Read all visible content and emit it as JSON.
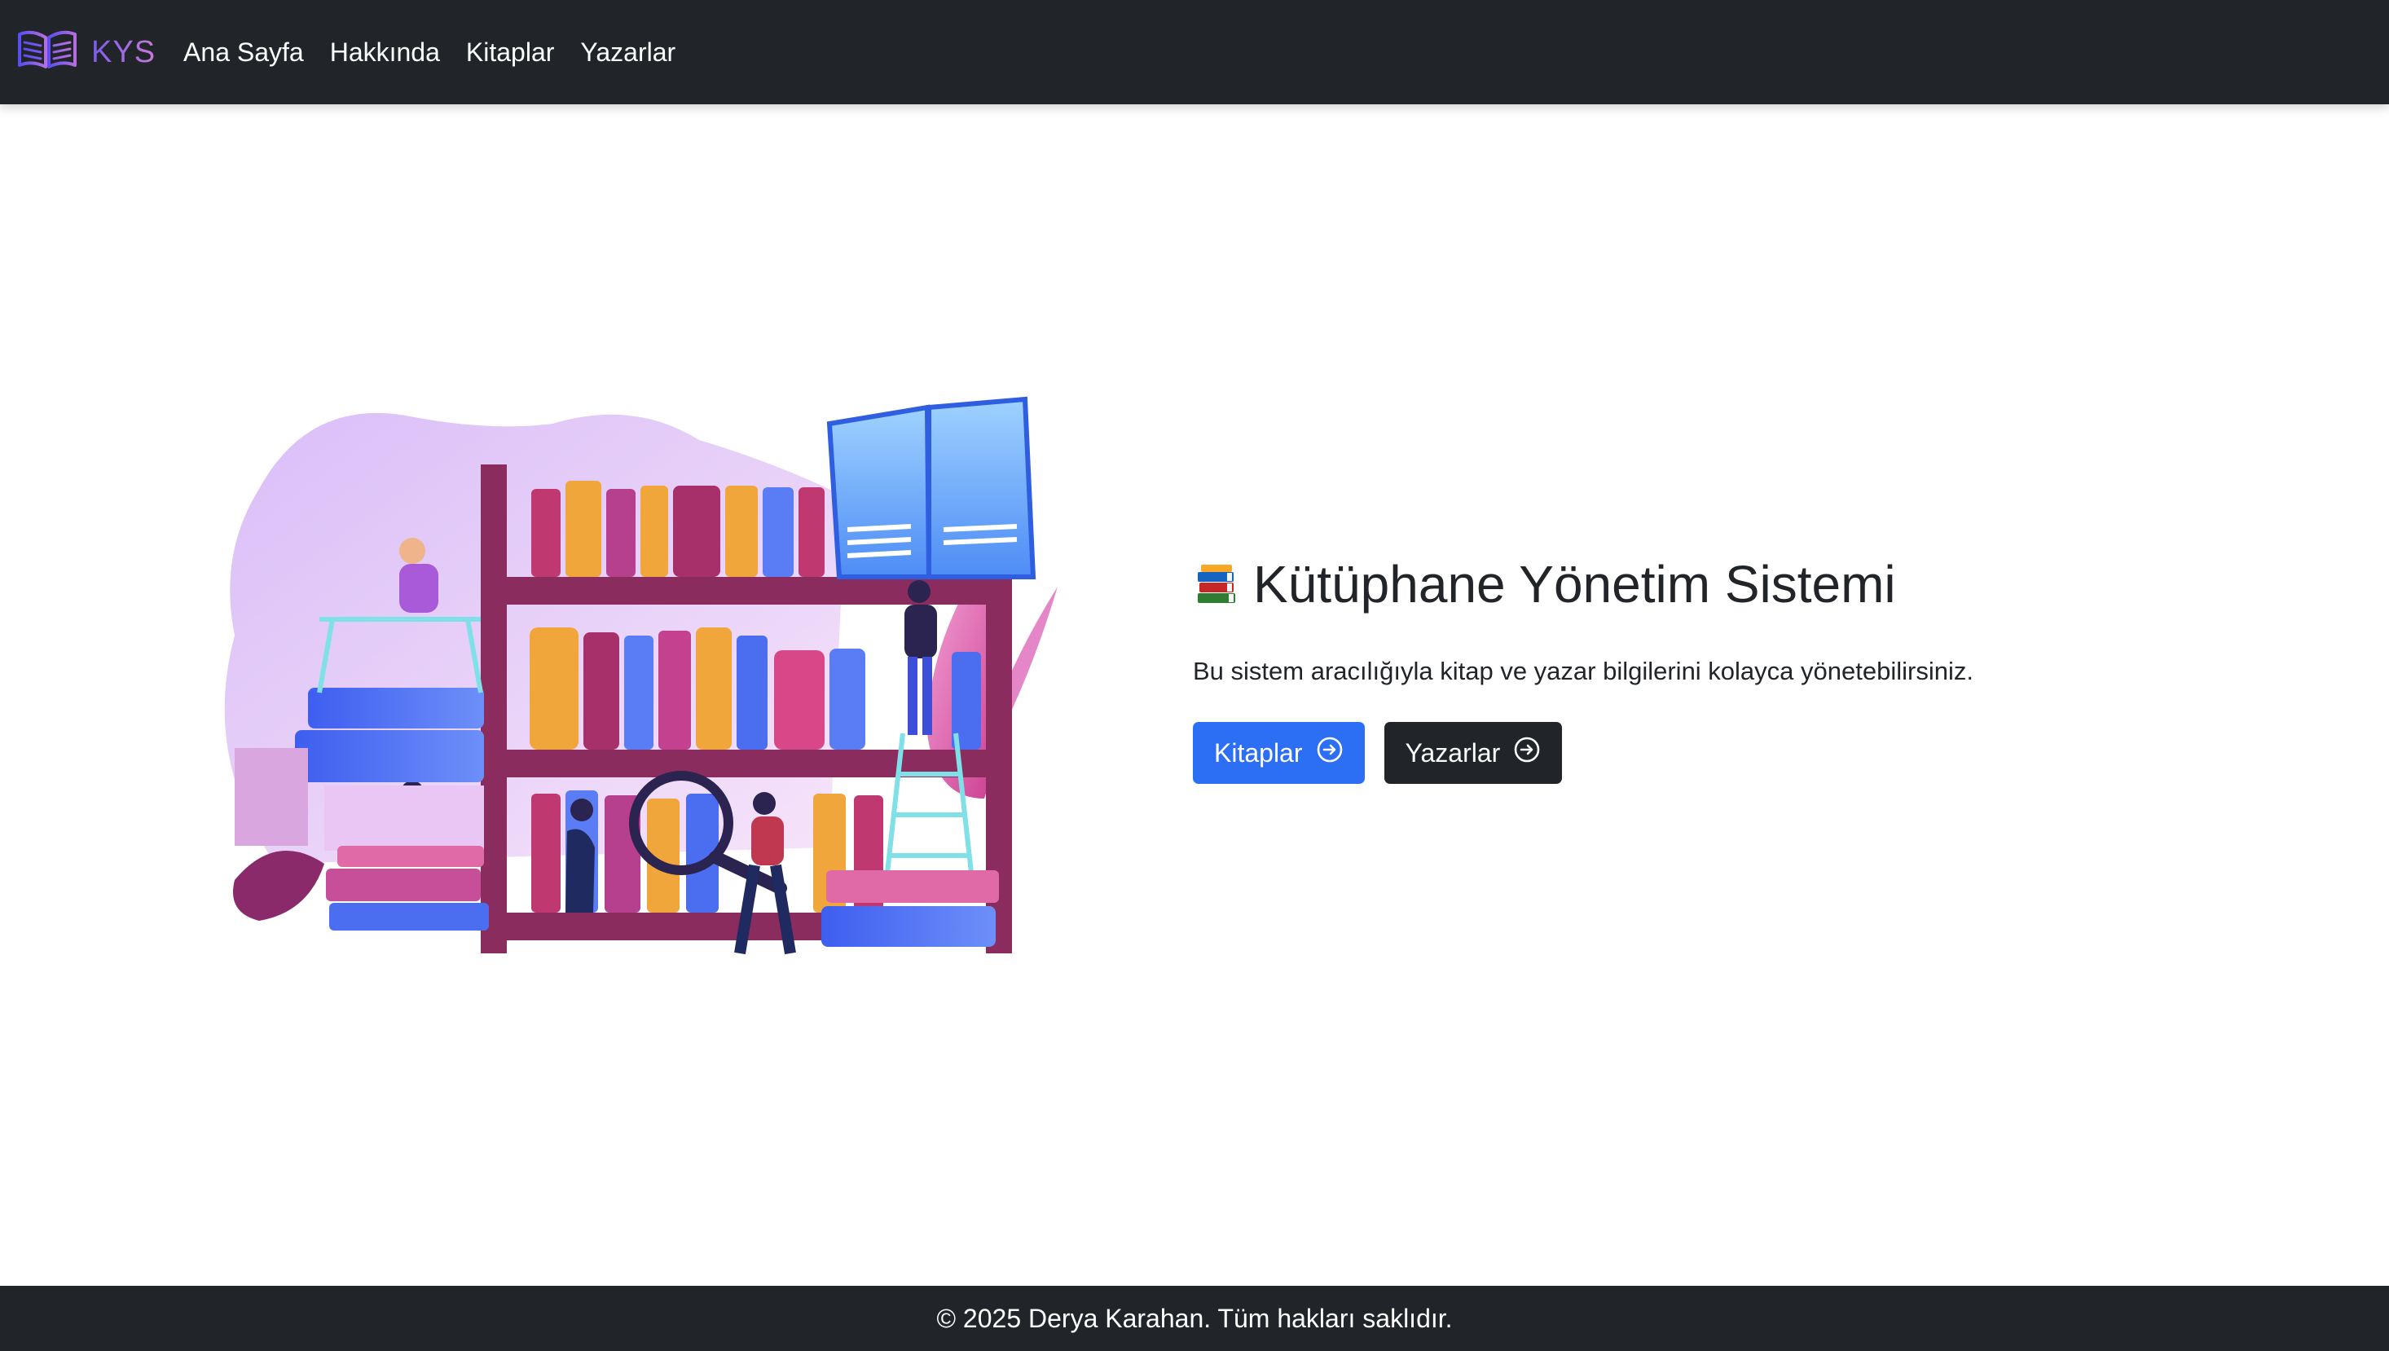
{
  "navbar": {
    "brand": "KYS",
    "brand_icon": "open-book-icon",
    "links": [
      {
        "label": "Ana Sayfa"
      },
      {
        "label": "Hakkında"
      },
      {
        "label": "Kitaplar"
      },
      {
        "label": "Yazarlar"
      }
    ]
  },
  "hero": {
    "illustration": "library-illustration",
    "title_emoji": "books-emoji-icon",
    "title": "Kütüphane Yönetim Sistemi",
    "description": "Bu sistem aracılığıyla kitap ve yazar bilgilerini kolayca yönetebilirsiniz.",
    "buttons": [
      {
        "label": "Kitaplar",
        "icon": "arrow-right-circle-icon",
        "color": "#2c6ff5"
      },
      {
        "label": "Yazarlar",
        "icon": "arrow-right-circle-icon",
        "color": "#212529"
      }
    ]
  },
  "footer": {
    "text": "© 2025 Derya Karahan. Tüm hakları saklıdır."
  },
  "colors": {
    "navbar_bg": "#212529",
    "primary": "#2c6ff5",
    "brand_gradient_start": "#7b5cf0",
    "brand_gradient_end": "#c77ad6"
  }
}
